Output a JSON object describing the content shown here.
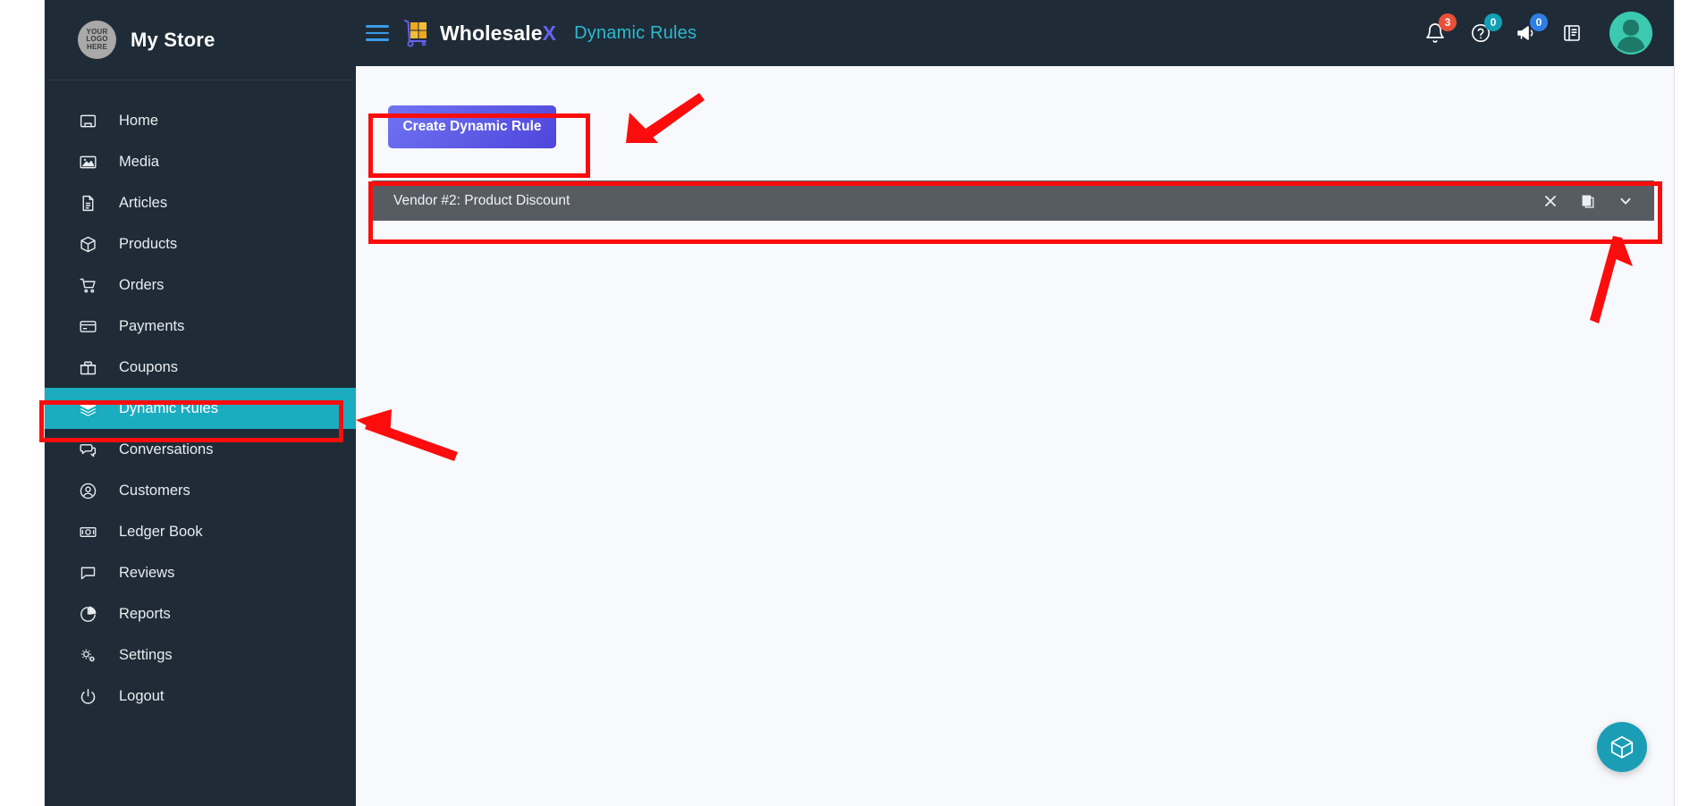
{
  "brand": {
    "logo_line1": "YOUR",
    "logo_line2": "LOGO",
    "logo_line3": "HERE",
    "store_name": "My Store"
  },
  "sidebar": {
    "items": [
      {
        "label": "Home",
        "icon": "home-icon",
        "active": false
      },
      {
        "label": "Media",
        "icon": "media-icon",
        "active": false
      },
      {
        "label": "Articles",
        "icon": "articles-icon",
        "active": false
      },
      {
        "label": "Products",
        "icon": "products-icon",
        "active": false
      },
      {
        "label": "Orders",
        "icon": "cart-icon",
        "active": false
      },
      {
        "label": "Payments",
        "icon": "credit-card-icon",
        "active": false
      },
      {
        "label": "Coupons",
        "icon": "gift-icon",
        "active": false
      },
      {
        "label": "Dynamic Rules",
        "icon": "layers-icon",
        "active": true
      },
      {
        "label": "Conversations",
        "icon": "chat-icon",
        "active": false
      },
      {
        "label": "Customers",
        "icon": "user-circle-icon",
        "active": false
      },
      {
        "label": "Ledger Book",
        "icon": "money-icon",
        "active": false
      },
      {
        "label": "Reviews",
        "icon": "comment-icon",
        "active": false
      },
      {
        "label": "Reports",
        "icon": "pie-chart-icon",
        "active": false
      },
      {
        "label": "Settings",
        "icon": "gears-icon",
        "active": false
      },
      {
        "label": "Logout",
        "icon": "power-icon",
        "active": false
      }
    ]
  },
  "topbar": {
    "menu_icon": "hamburger-icon",
    "app_logo_icon": "wholesalex-logo-icon",
    "app_name_main": "Wholesale",
    "app_name_accent": "X",
    "page_title": "Dynamic Rules",
    "icons": [
      {
        "name": "bell-icon",
        "badge": "3",
        "badge_color": "#e8503a"
      },
      {
        "name": "help-icon",
        "badge": "0",
        "badge_color": "#12a0b5"
      },
      {
        "name": "megaphone-icon",
        "badge": "0",
        "badge_color": "#2f7fe8"
      },
      {
        "name": "book-icon",
        "badge": "",
        "badge_color": ""
      }
    ],
    "avatar": "user-avatar"
  },
  "main": {
    "create_button_label": "Create Dynamic Rule",
    "rules": [
      {
        "title": "Vendor #2: Product Discount",
        "actions": [
          {
            "name": "close-icon",
            "glyph": "×"
          },
          {
            "name": "duplicate-icon",
            "glyph": "❐"
          },
          {
            "name": "chevron-down-icon",
            "glyph": "⌄"
          }
        ]
      }
    ]
  },
  "fab": {
    "icon": "cube-icon"
  },
  "colors": {
    "sidebar_bg": "#1f2c38",
    "active_nav": "#1cacc0",
    "page_title": "#2cb9cf",
    "create_button_start": "#6f74f2",
    "create_button_end": "#4f45db",
    "rule_row_bg": "#575c63",
    "content_bg": "#f8f9fc",
    "annotation": "#fb0d0d",
    "fab_bg": "#1b9eb5",
    "logo_x_accent": "#6563ef"
  }
}
